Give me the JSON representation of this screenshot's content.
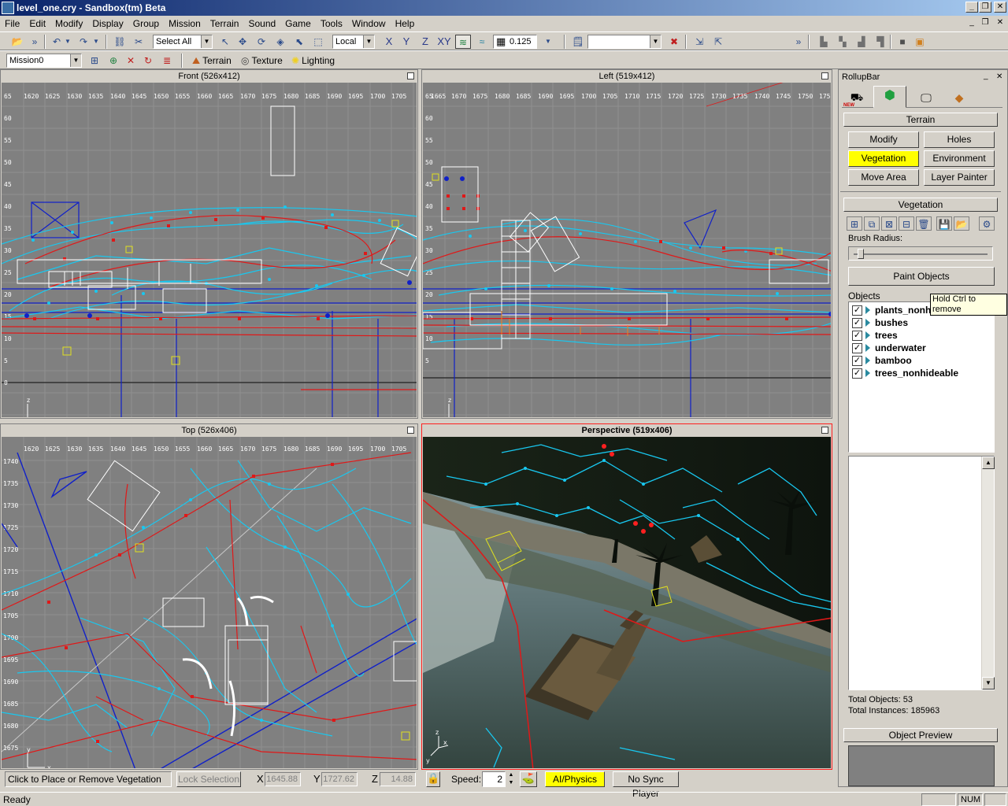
{
  "window": {
    "title": "level_one.cry - Sandbox(tm) Beta",
    "min_glyph": "_",
    "restore_glyph": "❐",
    "close_glyph": "✕"
  },
  "menu": {
    "items": [
      "File",
      "Edit",
      "Modify",
      "Display",
      "Group",
      "Mission",
      "Terrain",
      "Sound",
      "Game",
      "Tools",
      "Window",
      "Help"
    ]
  },
  "toolbar": {
    "select_filter": "Select All",
    "coord_system": "Local",
    "axis_x": "X",
    "axis_y": "Y",
    "axis_z": "Z",
    "axis_xy": "XY",
    "grid_size": "0.125",
    "overflow": "»"
  },
  "toolbar2": {
    "mission": "Mission0",
    "terrain_label": "Terrain",
    "texture_label": "Texture",
    "lighting_label": "Lighting"
  },
  "viewports": {
    "front": {
      "title": "Front (526x412)",
      "x_ticks": [
        "1620",
        "1625",
        "1630",
        "1635",
        "1640",
        "1645",
        "1650",
        "1655",
        "1660",
        "1665",
        "1670",
        "1675",
        "1680",
        "1685",
        "1690",
        "1695",
        "1700",
        "1705"
      ],
      "y_ticks": [
        "65",
        "60",
        "55",
        "50",
        "45",
        "40",
        "35",
        "30",
        "25",
        "20",
        "15",
        "10",
        "5",
        "0"
      ],
      "axis_a": "z",
      "axis_b": "x",
      "axis_c": "y"
    },
    "left": {
      "title": "Left (519x412)",
      "x_ticks": [
        "1665",
        "1670",
        "1675",
        "1680",
        "1685",
        "1690",
        "1695",
        "1700",
        "1705",
        "1710",
        "1715",
        "1720",
        "1725",
        "1730",
        "1735",
        "1740",
        "1745",
        "1750",
        "1755",
        "1760"
      ],
      "y_ticks": [
        "65",
        "60",
        "55",
        "50",
        "45",
        "40",
        "35",
        "30",
        "25",
        "20",
        "15",
        "10",
        "5"
      ],
      "axis_a": "z",
      "axis_b": "y",
      "axis_c": "x"
    },
    "top": {
      "title": "Top (526x406)",
      "x_ticks": [
        "1620",
        "1625",
        "1630",
        "1635",
        "1640",
        "1645",
        "1650",
        "1655",
        "1660",
        "1665",
        "1670",
        "1675",
        "1680",
        "1685",
        "1690",
        "1695",
        "1700",
        "1705"
      ],
      "y_ticks": [
        "1740",
        "1735",
        "1730",
        "1725",
        "1720",
        "1715",
        "1710",
        "1705",
        "1700",
        "1695",
        "1690",
        "1685",
        "1680",
        "1675"
      ],
      "axis_a": "y",
      "axis_b": "x"
    },
    "perspective": {
      "title": "Perspective (519x406)",
      "axis_a": "z",
      "axis_b": "x",
      "axis_c": "y"
    }
  },
  "rollup": {
    "title": "RollupBar",
    "new_badge": "NEW",
    "terrain_header": "Terrain",
    "buttons": {
      "modify": "Modify",
      "holes": "Holes",
      "vegetation": "Vegetation",
      "environment": "Environment",
      "move_area": "Move Area",
      "layer_painter": "Layer Painter"
    },
    "vegetation_header": "Vegetation",
    "brush_radius_label": "Brush Radius:",
    "brush_radius": 0.03,
    "paint_objects": "Paint Objects",
    "tooltip": "Hold Ctrl to remove",
    "objects_label": "Objects",
    "objects": [
      "plants_nonhideable",
      "bushes",
      "trees",
      "underwater",
      "bamboo",
      "trees_nonhideable"
    ],
    "total_objects": "Total Objects: 53",
    "total_instances": "Total Instances: 185963",
    "object_preview_header": "Object Preview"
  },
  "statusbar": {
    "hint": "Click to Place or Remove Vegetation",
    "lock_selection": "Lock Selection",
    "x_label": "X",
    "x_value": "1645.88",
    "y_label": "Y",
    "y_value": "1727.62",
    "z_label": "Z",
    "z_value": "14.88",
    "speed_label": "Speed:",
    "speed_value": "2",
    "ai_physics": "AI/Physics",
    "no_sync": "No Sync Player",
    "ready": "Ready",
    "num": "NUM"
  },
  "colors": {
    "ai_path": "#18c8f0",
    "red_path": "#e01818",
    "blue_line": "#1020c8",
    "highlight_yellow": "#ffff00",
    "viewport_grey": "#808080",
    "active_border": "#ff2020"
  }
}
